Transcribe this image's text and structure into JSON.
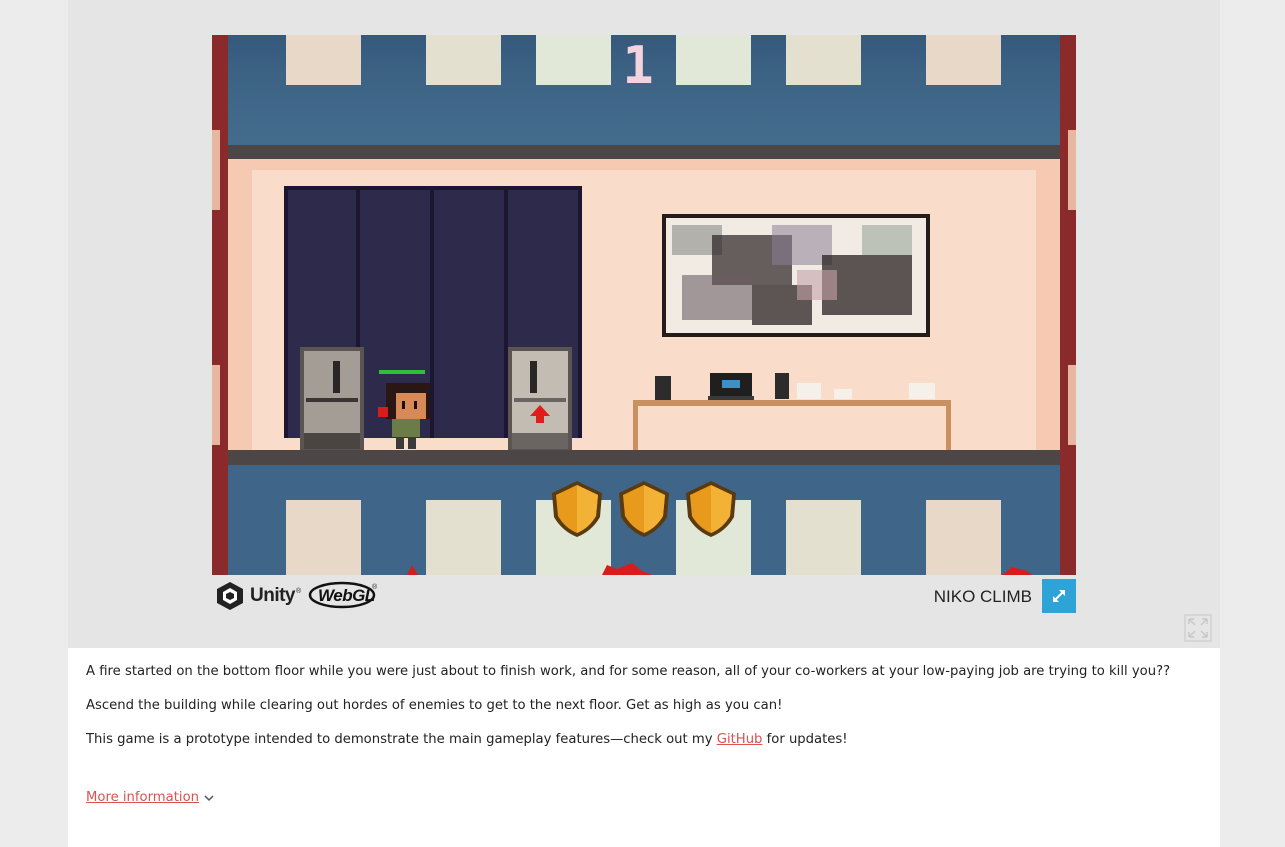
{
  "game": {
    "floor_number": "1",
    "title": "NIKO CLIMB",
    "shields": 3
  },
  "footer": {
    "engine_label": "Unity",
    "engine_mark": "®",
    "platform_label": "WebGL",
    "platform_mark": "®"
  },
  "description": {
    "para1": "A fire started on the bottom floor while you were just about to finish work, and for some reason, all of your co-workers at your low-paying job are trying to kill you??",
    "para2": "Ascend the building while clearing out hordes of enemies to get to the next floor. Get as high as you can!",
    "para3_before": "This game is a prototype intended to demonstrate the main gameplay features—check out my ",
    "para3_link": "GitHub",
    "para3_after": " for updates!",
    "more_info": "More information"
  },
  "icons": {
    "fullscreen": "expand-arrows-icon",
    "page_fullscreen": "fullscreen-corners-icon",
    "chevron": "chevron-down-icon",
    "unity": "unity-cube-icon"
  },
  "colors": {
    "link": "#d9534f",
    "fullscreen_button": "#2ea3d8",
    "wall": "#f7d6c2",
    "building_blue": "#3d6585"
  }
}
